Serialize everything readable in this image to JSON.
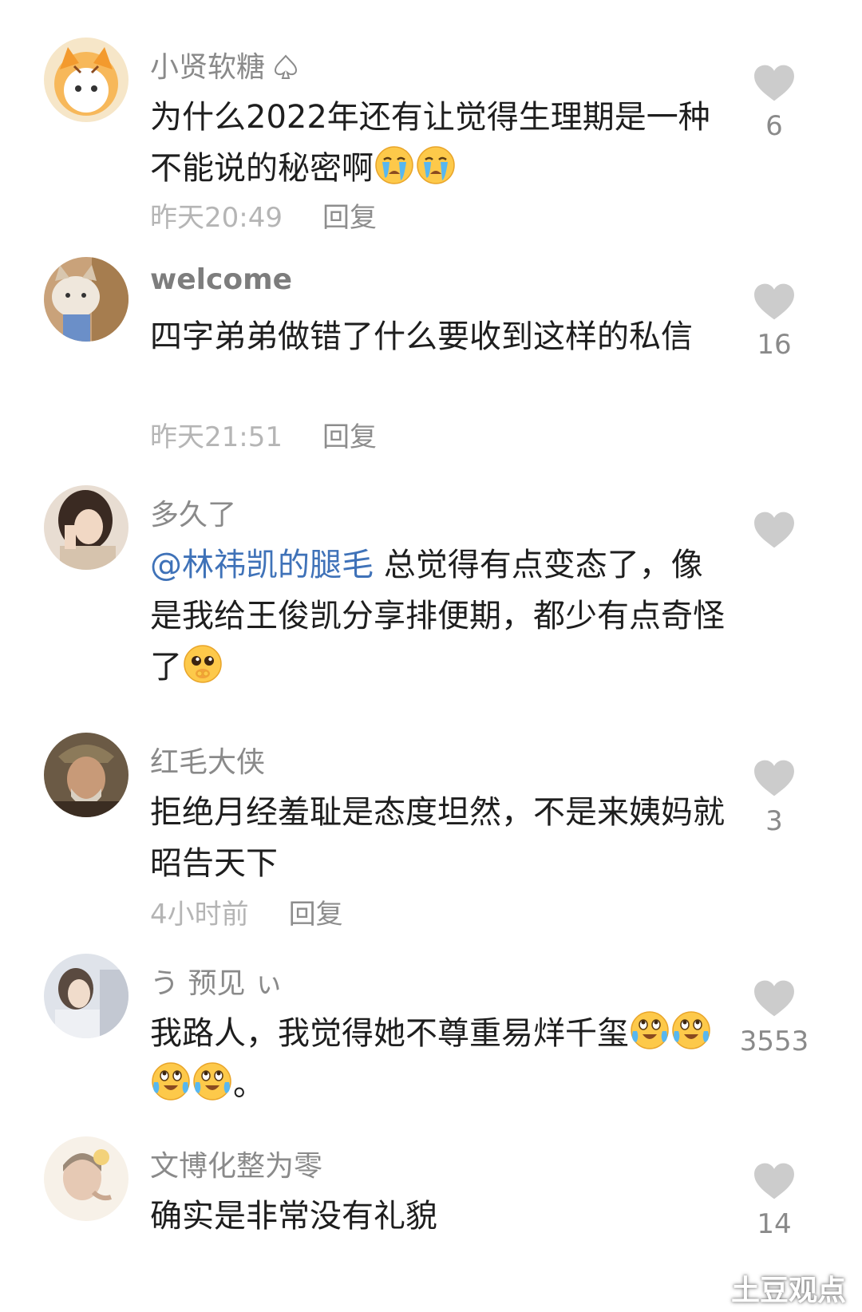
{
  "comments": [
    {
      "username": "小贤软糖",
      "text_parts": [
        "为什么2022年还有让觉得生理期是一种不能说的秘密啊"
      ],
      "time": "昨天20:49",
      "reply_label": "回复",
      "likes": "6"
    },
    {
      "username": "welcome",
      "text_parts": [
        "四字弟弟做错了什么要收到这样的私信"
      ],
      "time": "昨天21:51",
      "reply_label": "回复",
      "likes": "16"
    },
    {
      "username": "多久了",
      "mention": "@林祎凯的腿毛",
      "text_parts": [
        " 总觉得有点变态了，像是我给王俊凯分享排便期，都少有点奇怪了"
      ],
      "likes": ""
    },
    {
      "username": "红毛大侠",
      "text_parts": [
        "拒绝月经羞耻是态度坦然，不是来姨妈就昭告天下"
      ],
      "time": "4小时前",
      "reply_label": "回复",
      "likes": "3"
    },
    {
      "username": "う 预见 ぃ",
      "text_parts": [
        "我路人，我觉得她不尊重易烊千玺",
        "。"
      ],
      "likes": "3553"
    },
    {
      "username": "文博化整为零",
      "text_parts": [
        "确实是非常没有礼貌"
      ],
      "likes": "14"
    }
  ],
  "watermark": "土豆观点",
  "colors": {
    "mention": "#3f72b8",
    "heart": "#cccccc",
    "text": "#1e1e1e",
    "meta": "#b5b5b5"
  },
  "icons": {
    "like": "heart-icon",
    "emoji_cry": "crying-face-emoji",
    "emoji_pleading": "pleading-face-emoji",
    "emoji_tears_joy": "tearful-upward-face-emoji",
    "spade": "spade-icon"
  }
}
